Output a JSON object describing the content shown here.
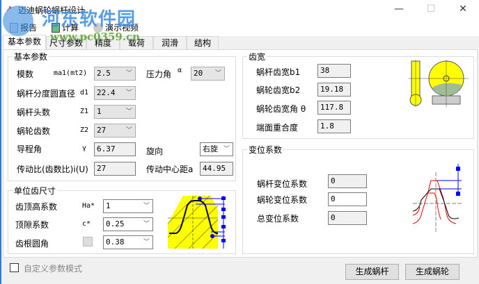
{
  "window": {
    "title": "迈迪蜗轮蜗杆设计",
    "minimize": "—",
    "maximize": "☐",
    "close": "✕"
  },
  "toolbar": {
    "report": "报告",
    "calc": "计算",
    "demo": "演示视频"
  },
  "tabs": [
    "基本参数",
    "尺寸参数",
    "精度",
    "载荷",
    "润滑",
    "结构"
  ],
  "basic": {
    "title": "基本参数",
    "module": {
      "label": "模数",
      "sym": "ma1(mt2)",
      "value": "2.5"
    },
    "pressure": {
      "label": "压力角",
      "sym": "α",
      "value": "20"
    },
    "d1": {
      "label": "蜗杆分度圆直径",
      "sym": "d1",
      "value": "22.4"
    },
    "z1": {
      "label": "蜗杆头数",
      "sym": "Z1",
      "value": "1"
    },
    "z2": {
      "label": "蜗轮齿数",
      "sym": "Z2",
      "value": "27"
    },
    "lead": {
      "label": "导程角",
      "sym": "γ",
      "value": "6.37"
    },
    "hand": {
      "label": "旋向",
      "value": "右旋"
    },
    "ratio": {
      "label": "传动比(齿数比)i(U)",
      "value": "27"
    },
    "center": {
      "label": "传动中心距a",
      "value": "44.95"
    }
  },
  "unit": {
    "title": "单位齿尺寸",
    "ha": {
      "label": "齿顶高系数",
      "sym": "Ha*",
      "value": "1"
    },
    "c": {
      "label": "顶隙系数",
      "sym": "c*",
      "value": "0.25"
    },
    "rf": {
      "label": "齿根圆角",
      "value": "0.38"
    }
  },
  "custom": {
    "label": "自定义参数模式",
    "checked": false
  },
  "width": {
    "title": "齿宽",
    "b1": {
      "label": "蜗杆齿宽b1",
      "value": "38"
    },
    "b2": {
      "label": "蜗轮齿宽b2",
      "value": "19.18"
    },
    "theta": {
      "label": "蜗轮齿宽角 θ",
      "value": "117.8"
    },
    "overlap": {
      "label": "端面重合度",
      "value": "1.8"
    }
  },
  "shift": {
    "title": "变位系数",
    "x1": {
      "label": "蜗杆变位系数",
      "value": "0"
    },
    "x2": {
      "label": "蜗轮变位系数",
      "value": "0"
    },
    "total": {
      "label": "总变位系数",
      "value": "0"
    }
  },
  "buttons": {
    "worm": "生成蜗杆",
    "wheel": "生成蜗轮"
  },
  "watermark": {
    "name": "河东软件园",
    "url": "www.pc0359.cn"
  }
}
